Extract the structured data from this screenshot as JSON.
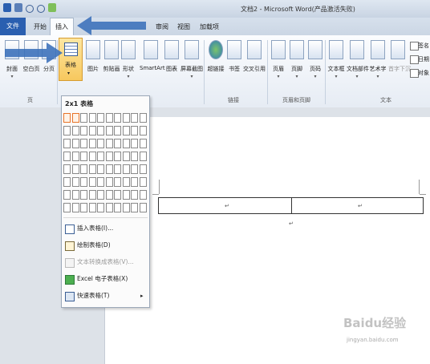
{
  "window": {
    "title": "文档2 - Microsoft Word(产品激活失败)"
  },
  "tabs": {
    "file": "文件",
    "home": "开始",
    "insert": "插入",
    "review": "审阅",
    "view": "视图",
    "addins": "加载项"
  },
  "ribbon": {
    "pages": [
      "封面",
      "空白页",
      "分页"
    ],
    "table": "表格",
    "illustrations": [
      "图片",
      "剪贴画",
      "形状",
      "SmartArt",
      "图表",
      "屏幕截图"
    ],
    "links": [
      "超链接",
      "书签",
      "交叉引用"
    ],
    "header_footer": [
      "页眉",
      "页脚",
      "页码"
    ],
    "text": [
      "文本框",
      "文档部件",
      "艺术字",
      "首字下沉"
    ],
    "right_small": [
      "签名",
      "日期",
      "对象"
    ],
    "groups": {
      "pages": "页",
      "links": "链接",
      "header_footer": "页眉和页脚",
      "text": "文本"
    }
  },
  "dropdown": {
    "title": "2x1 表格",
    "grid": {
      "cols": 10,
      "rows": 8,
      "selected_cols": 2,
      "selected_rows": 1
    },
    "items": [
      "插入表格(I)...",
      "绘制表格(D)",
      "文本转换成表格(V)...",
      "Excel 电子表格(X)",
      "快速表格(T)"
    ],
    "item_state": [
      true,
      true,
      false,
      true,
      true
    ],
    "item_submenu": [
      false,
      false,
      false,
      false,
      true
    ],
    "submenu_arrow": "▸"
  },
  "document": {
    "marks": [
      "↵",
      "↵",
      "↵"
    ]
  },
  "watermark": {
    "brand": "Baidu经验",
    "url": "jingyan.baidu.com"
  },
  "colors": {
    "accent": "#2a5fb0",
    "highlight": "#f7c85e",
    "arrow": "#3a6fb9"
  }
}
